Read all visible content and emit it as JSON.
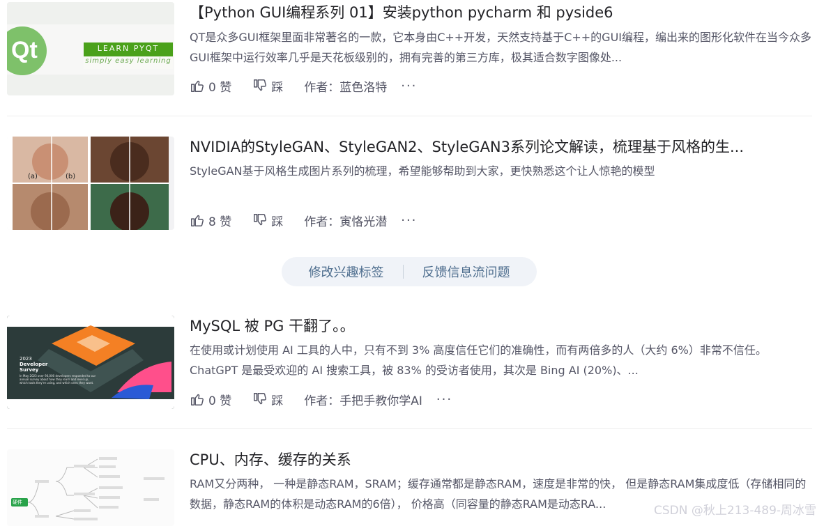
{
  "articles": [
    {
      "title": "【Python GUI编程系列 01】安装python pycharm 和 pyside6",
      "desc": "QT是众多GUI框架里面非常著名的一款，它本身由C++开发，天然支持基于C++的GUI编程，编出来的图形化软件在当今众多GUI框架中运行效率几乎是天花板级别的，拥有完善的第三方库，极其适合数字图像处...",
      "likes": "0 赞",
      "dislike": "踩",
      "author": "作者：蓝色洛特",
      "thumb_text_1": "LEARN PYQT",
      "thumb_text_2": "simply easy learning",
      "thumb_logo": "Qt"
    },
    {
      "title": "NVIDIA的StyleGAN、StyleGAN2、StyleGAN3系列论文解读，梳理基于风格的生...",
      "desc": "StyleGAN基于风格生成图片系列的梳理，希望能够帮助到大家，更快熟悉这个让人惊艳的模型",
      "likes": "8 赞",
      "dislike": "踩",
      "author": "作者：寅恪光潜",
      "thumb_label_a": "(a)",
      "thumb_label_b": "(b)"
    },
    {
      "title": "MySQL 被 PG 干翻了。。",
      "desc": "在使用或计划使用 AI 工具的人中，只有不到 3% 高度信任它们的准确性，而有两倍多的人（大约 6%）非常不信任。ChatGPT 是最受欢迎的 AI 搜索工具，被 83% 的受访者使用，其次是 Bing AI (20%)、...",
      "likes": "0 赞",
      "dislike": "踩",
      "author": "作者：手把手教你学AI",
      "thumb_year": "2023",
      "thumb_heading": "Developer Survey",
      "thumb_caption": "In May 2023 over 90,000 developers responded to our annual survey about how they learn and level up, which tools they're using, and which ones they want."
    },
    {
      "title": "CPU、内存、缓存的关系",
      "desc": "RAM又分两种， 一种是静态RAM，SRAM；缓存通常都是静态RAM，速度是非常的快， 但是静态RAM集成度低（存储相同的数据，静态RAM的体积是动态RAM的6倍）， 价格高（同容量的静态RAM是动态RA...",
      "thumb_root": "硬件"
    }
  ],
  "pill": {
    "left": "修改兴趣标签",
    "right": "反馈信息流问题"
  },
  "more": "···",
  "watermark": "CSDN @秋上213-489-周冰雪",
  "colors": {
    "accent": "#4e6e8e",
    "green": "#41cd52",
    "darkgreen": "#4aa11a"
  },
  "icons": {
    "like": "thumb-up-icon",
    "dislike": "thumb-down-icon"
  }
}
